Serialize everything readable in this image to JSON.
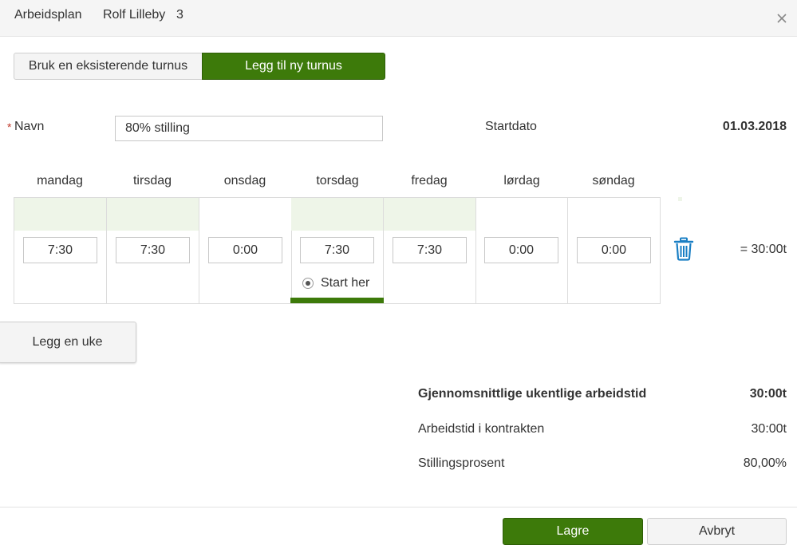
{
  "header": {
    "title": "Arbeidsplan",
    "employee": "Rolf Lilleby",
    "number": "3",
    "close_icon": "close-icon"
  },
  "toggle": {
    "existing_label": "Bruk en eksisterende turnus",
    "new_label": "Legg til ny turnus",
    "selected": "new"
  },
  "form": {
    "name_required_mark": "*",
    "name_label": "Navn",
    "name_value": "80% stilling",
    "startdate_label": "Startdato",
    "startdate_value": "01.03.2018"
  },
  "week": {
    "days": [
      {
        "label": "mandag",
        "hours": "7:30",
        "workday": true
      },
      {
        "label": "tirsdag",
        "hours": "7:30",
        "workday": true
      },
      {
        "label": "onsdag",
        "hours": "0:00",
        "workday": false
      },
      {
        "label": "torsdag",
        "hours": "7:30",
        "workday": true,
        "start_here": true
      },
      {
        "label": "fredag",
        "hours": "7:30",
        "workday": true
      },
      {
        "label": "lørdag",
        "hours": "0:00",
        "workday": false
      },
      {
        "label": "søndag",
        "hours": "0:00",
        "workday": false
      }
    ],
    "start_here_label": "Start her",
    "total": "= 30:00t",
    "delete_icon": "trash-icon"
  },
  "add_week_label": "Legg en uke",
  "summary": {
    "avg_label": "Gjennomsnittlige ukentlige arbeidstid",
    "avg_value": "30:00t",
    "contract_label": "Arbeidstid i kontrakten",
    "contract_value": "30:00t",
    "percent_label": "Stillingsprosent",
    "percent_value": "80,00%"
  },
  "footer": {
    "save_label": "Lagre",
    "cancel_label": "Avbryt"
  },
  "colors": {
    "accent_green": "#3d7a0a",
    "workday_band": "#eef5e8",
    "trash_blue": "#1a7fc4",
    "required_red": "#c0392b"
  }
}
